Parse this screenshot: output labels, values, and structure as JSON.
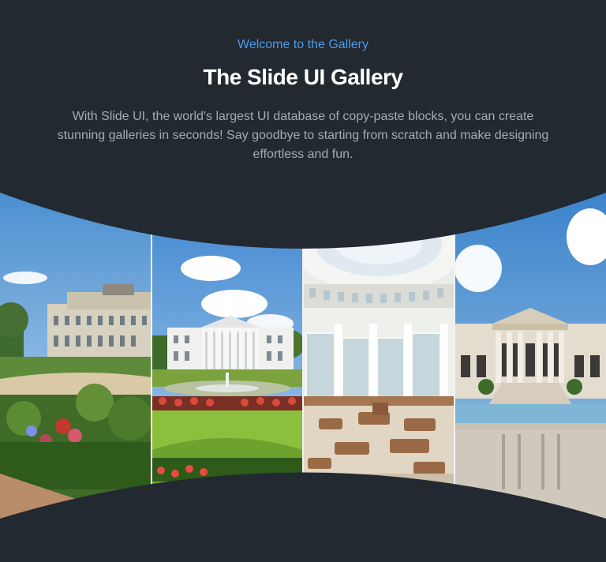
{
  "header": {
    "eyebrow": "Welcome to the Gallery",
    "title": "The Slide UI Gallery",
    "description": "With Slide UI, the world's largest UI database of copy-paste blocks, you can create stunning galleries in seconds! Say goodbye to starting from scratch and make designing effortless and fun."
  },
  "colors": {
    "background": "#232931",
    "accent": "#4d9be6",
    "title": "#ffffff",
    "body_text": "#a4abb5"
  },
  "gallery": {
    "images": [
      {
        "subject": "palace garden"
      },
      {
        "subject": "white house lawn"
      },
      {
        "subject": "rotunda interior"
      },
      {
        "subject": "columned building pool"
      }
    ]
  }
}
